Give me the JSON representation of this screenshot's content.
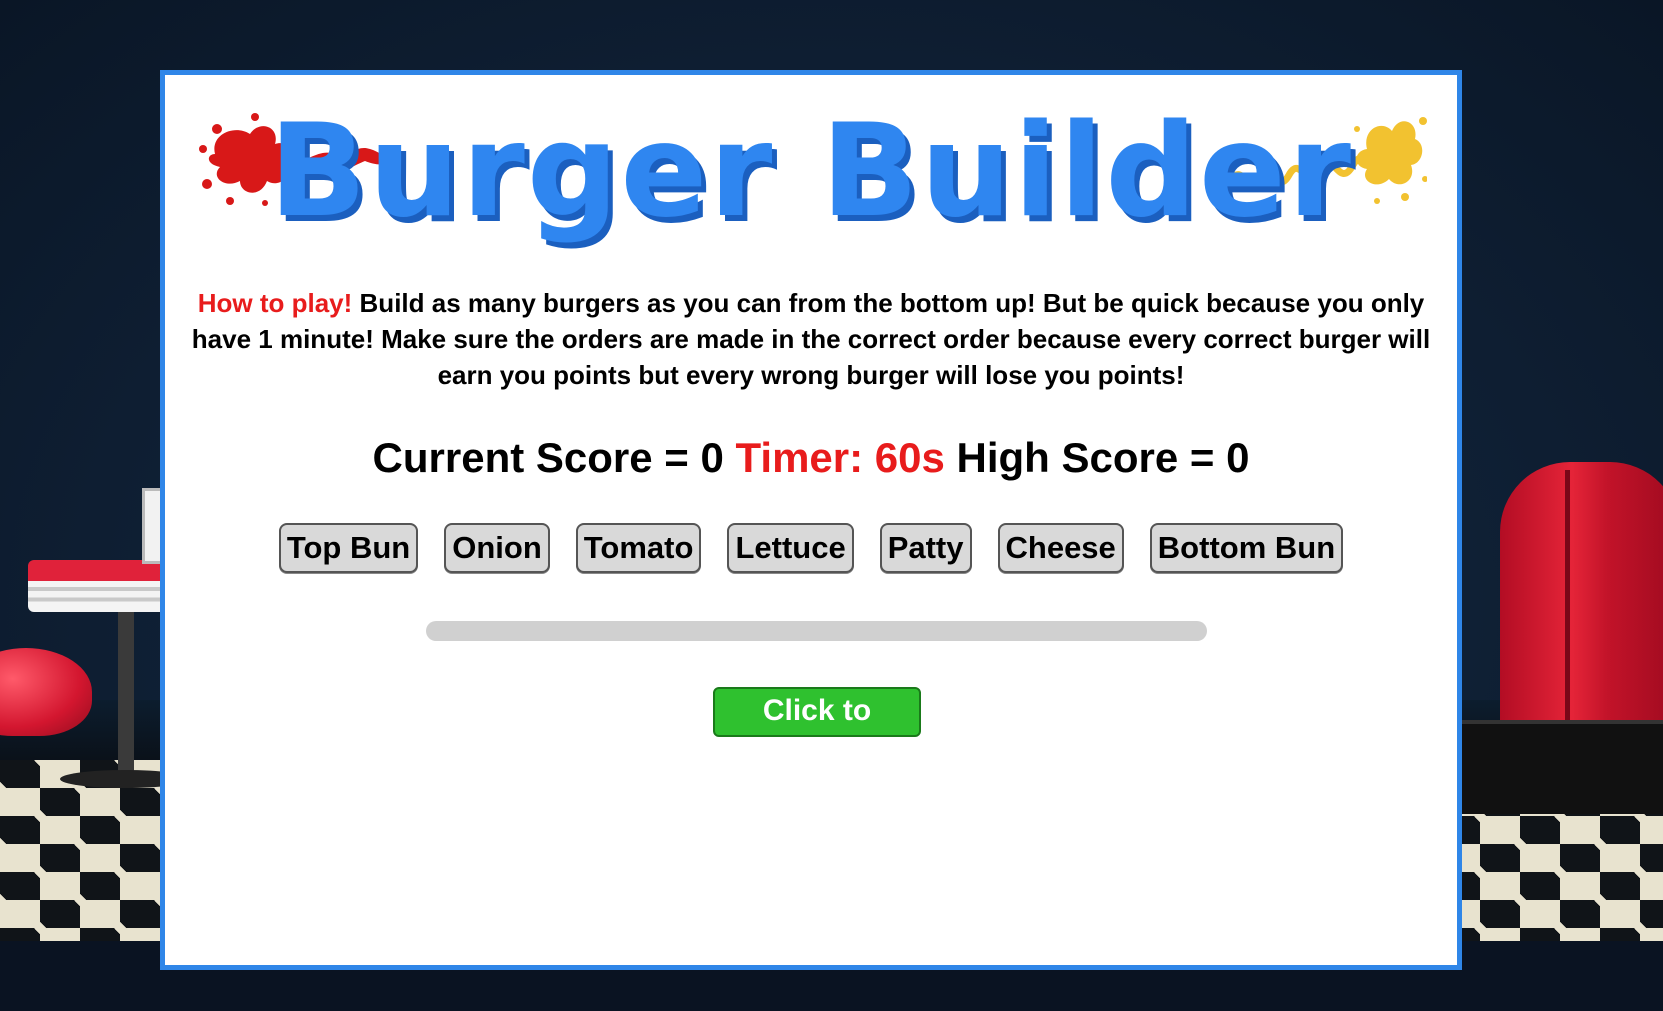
{
  "game": {
    "title": "Burger Builder",
    "instructions": {
      "label": "How to play!",
      "text": "Build as many burgers as you can from the bottom up! But be quick because you only have 1 minute! Make sure the orders are made in the correct order because every correct burger will earn you points but every wrong burger will lose you points!"
    },
    "scoreboard": {
      "current_score_label": "Current Score = 0",
      "timer_label": "Timer: 60s",
      "high_score_label": "High Score = 0",
      "current_score": 0,
      "timer_seconds": 60,
      "high_score": 0
    },
    "ingredients": [
      {
        "label": "Top Bun"
      },
      {
        "label": "Onion"
      },
      {
        "label": "Tomato"
      },
      {
        "label": "Lettuce"
      },
      {
        "label": "Patty"
      },
      {
        "label": "Cheese"
      },
      {
        "label": "Bottom Bun"
      }
    ],
    "progress": {
      "fraction": 0
    },
    "start_button": {
      "label": "Click to Begin!"
    }
  },
  "colors": {
    "accent_blue": "#2f86e8",
    "title_blue": "#2f86f0",
    "timer_red": "#e81c1c",
    "start_green": "#2fc12f",
    "ketchup_red": "#d81818",
    "mustard_yellow": "#f2c230"
  },
  "icons": [
    "ketchup-splat-icon",
    "mustard-splat-icon"
  ]
}
